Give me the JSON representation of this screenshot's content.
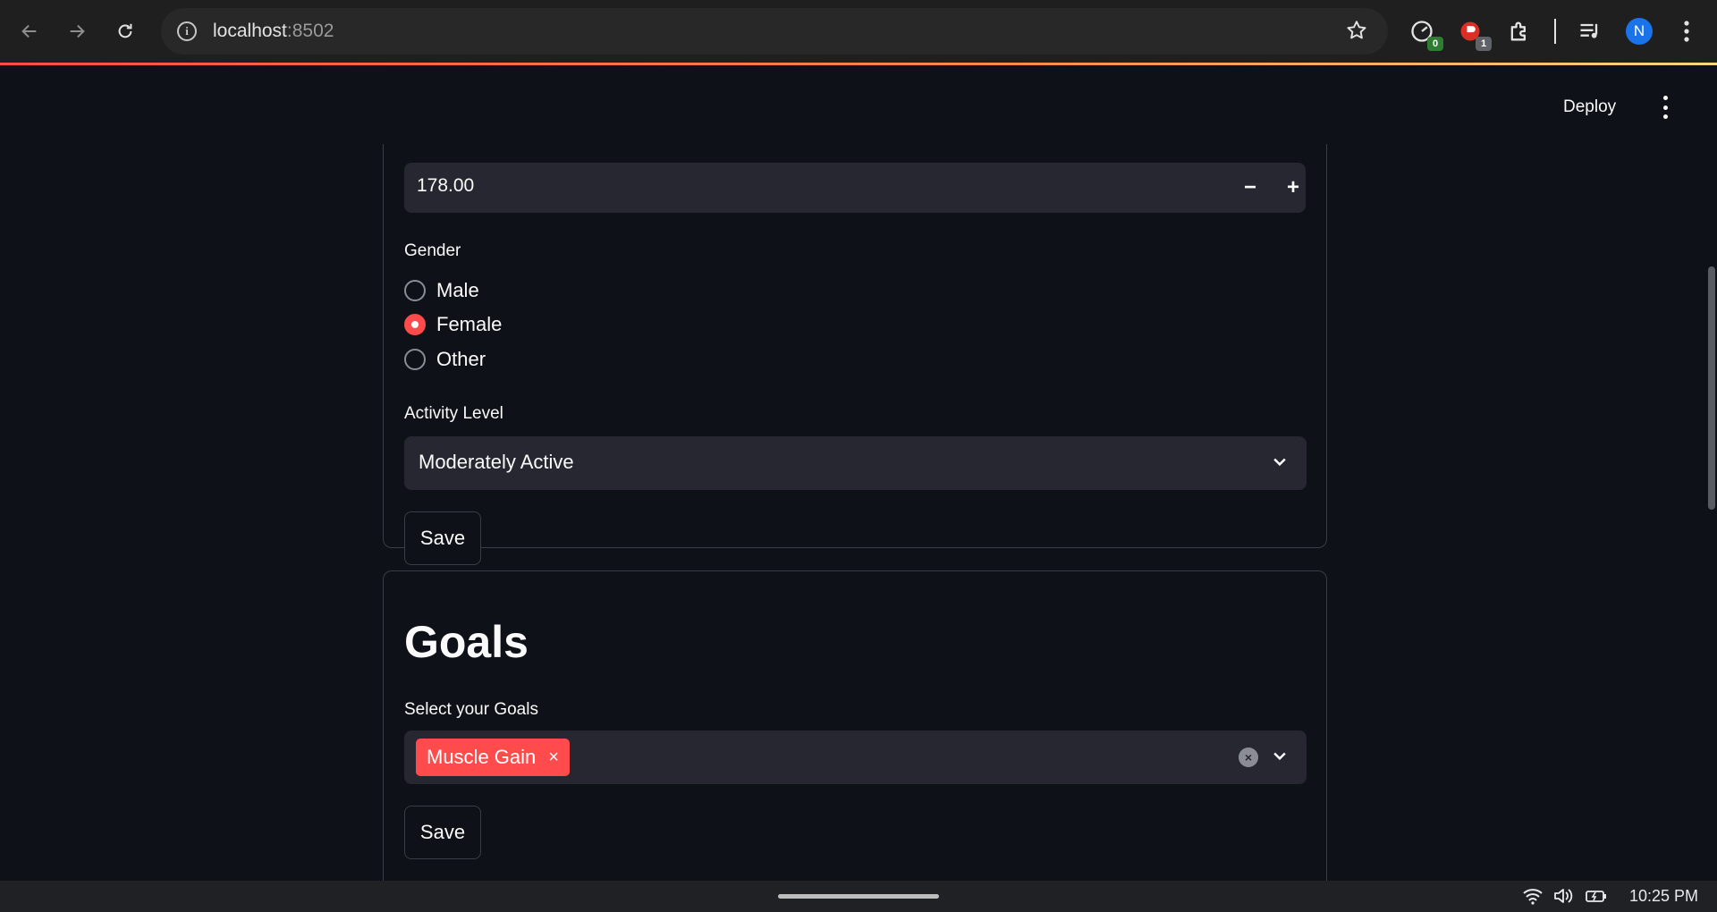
{
  "browser": {
    "url_host": "localhost",
    "url_port": ":8502",
    "extensions": [
      {
        "name": "speed-extension",
        "badge": "0",
        "badge_color": "#2e7d32"
      },
      {
        "name": "red-extension",
        "badge": "1",
        "badge_color": "#5f6368"
      }
    ],
    "profile_initial": "N"
  },
  "app_header": {
    "deploy_label": "Deploy"
  },
  "profile_form": {
    "height_value": "178.00",
    "minus_label": "−",
    "plus_label": "+",
    "gender_label": "Gender",
    "gender_options": [
      {
        "label": "Male",
        "selected": false
      },
      {
        "label": "Female",
        "selected": true
      },
      {
        "label": "Other",
        "selected": false
      }
    ],
    "activity_label": "Activity Level",
    "activity_value": "Moderately Active",
    "save_label": "Save"
  },
  "goals": {
    "title": "Goals",
    "select_label": "Select your Goals",
    "selected_chips": [
      {
        "label": "Muscle Gain",
        "remove": "×"
      }
    ],
    "clear_label": "×",
    "save_label": "Save"
  },
  "taskbar": {
    "time": "10:25 PM"
  },
  "colors": {
    "accent": "#ff4b4b",
    "background": "#0e1117",
    "input_bg": "#262730"
  }
}
